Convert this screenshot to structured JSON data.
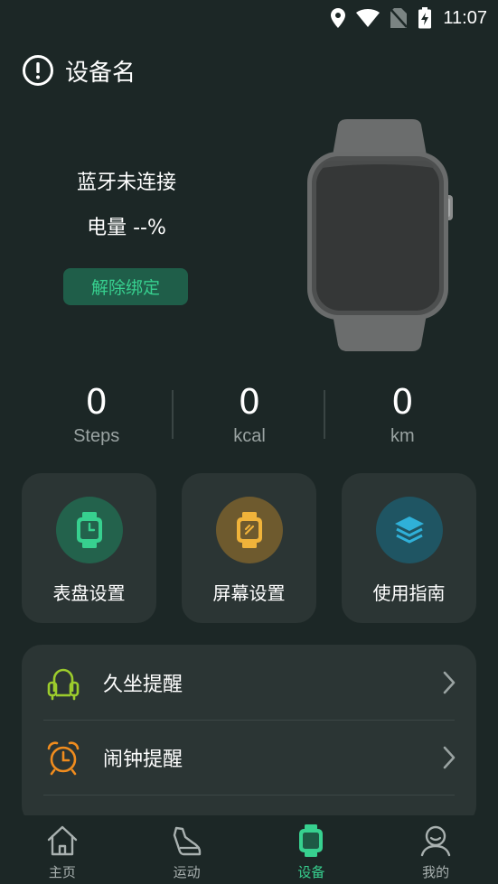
{
  "status_bar": {
    "time": "11:07"
  },
  "header": {
    "title": "设备名"
  },
  "device": {
    "connection_status": "蓝牙未连接",
    "battery": "电量 --%",
    "unbind_label": "解除绑定"
  },
  "stats": [
    {
      "value": "0",
      "unit": "Steps"
    },
    {
      "value": "0",
      "unit": "kcal"
    },
    {
      "value": "0",
      "unit": "km"
    }
  ],
  "cards": [
    {
      "label": "表盘设置",
      "icon": "watch-face-icon",
      "color": "#37d08f"
    },
    {
      "label": "屏幕设置",
      "icon": "screen-icon",
      "color": "#f0b33a"
    },
    {
      "label": "使用指南",
      "icon": "layers-icon",
      "color": "#2fb0d8"
    }
  ],
  "list": [
    {
      "label": "久坐提醒",
      "icon": "sedentary-icon",
      "color": "#9ccc2c"
    },
    {
      "label": "闹钟提醒",
      "icon": "alarm-clock-icon",
      "color": "#f08c1e"
    }
  ],
  "nav": [
    {
      "label": "主页",
      "icon": "home-icon"
    },
    {
      "label": "运动",
      "icon": "shoe-icon"
    },
    {
      "label": "设备",
      "icon": "device-icon",
      "active": true
    },
    {
      "label": "我的",
      "icon": "profile-icon"
    }
  ],
  "colors": {
    "accent": "#37d08f",
    "background": "#1c2726",
    "card": "#2b3534"
  }
}
